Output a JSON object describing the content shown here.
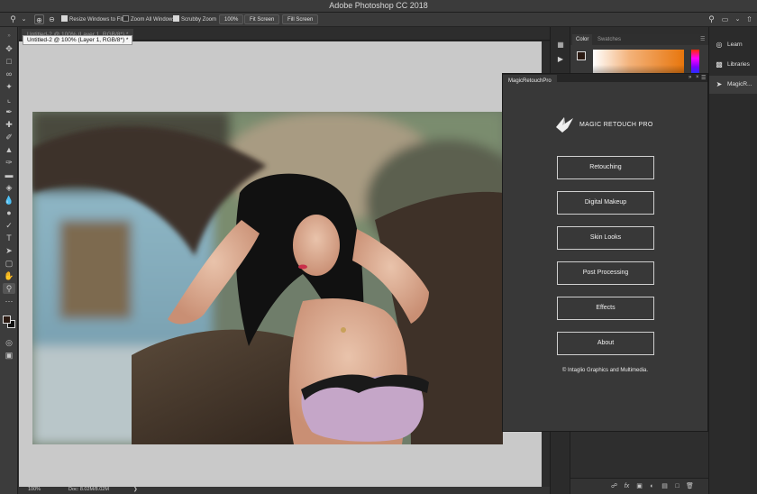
{
  "app": {
    "title": "Adobe Photoshop CC 2018"
  },
  "options_bar": {
    "resize_windows": "Resize Windows to Fit",
    "zoom_all": "Zoom All Windows",
    "scrubby_zoom": "Scrubby Zoom",
    "zoom_value": "100%",
    "fit_screen_1": "Fit Screen",
    "fit_screen_2": "Fill Screen"
  },
  "document": {
    "tab_label": "Untitled-2 @ 100% (Layer 1, RGB/8*) *",
    "tooltip": "Untitled-2 @ 100% (Layer 1, RGB/8*) *"
  },
  "status_bar": {
    "zoom": "100%",
    "doc_info": "Doc: 8.02M/8.02M"
  },
  "color_panel": {
    "tab_color": "Color",
    "tab_swatches": "Swatches",
    "foreground": "#2b1a12",
    "background": "#111111"
  },
  "learn_library": {
    "learn": "Learn",
    "libraries": "Libraries",
    "magic": "MagicR..."
  },
  "magic_retouch": {
    "panel_title": "MagicRetouchPro",
    "logo_text": "MAGIC RETOUCH PRO",
    "buttons": [
      "Retouching",
      "Digital Makeup",
      "Skin Looks",
      "Post Processing",
      "Effects",
      "About"
    ],
    "copyright": "© Intaglio Graphics and Multimedia."
  }
}
